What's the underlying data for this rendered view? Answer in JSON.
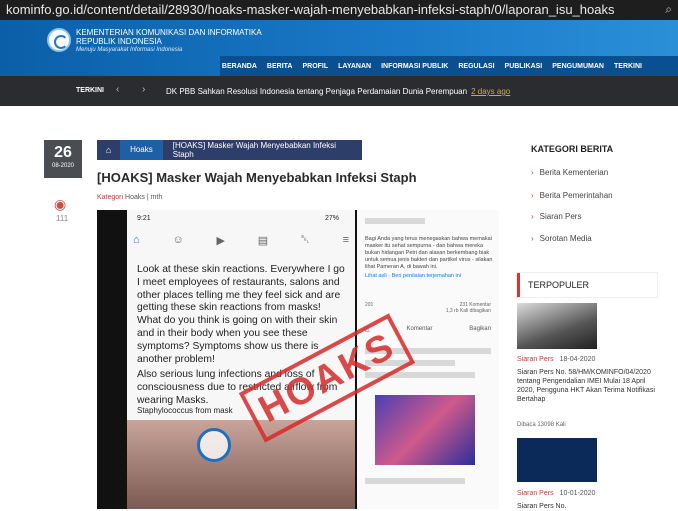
{
  "browser": {
    "url": "kominfo.go.id/content/detail/28930/hoaks-masker-wajah-menyebabkan-infeksi-staph/0/laporan_isu_hoaks"
  },
  "header": {
    "ministry_line1": "KEMENTERIAN KOMUNIKASI DAN INFORMATIKA",
    "ministry_line2": "REPUBLIK INDONESIA",
    "tagline": "Menuju Masyarakat Informasi Indonesia",
    "nav": [
      "BERANDA",
      "BERITA",
      "PROFIL",
      "LAYANAN",
      "INFORMASI PUBLIK",
      "REGULASI",
      "PUBLIKASI",
      "PENGUMUMAN",
      "TERKINI"
    ]
  },
  "ticker": {
    "label": "TERKINI",
    "headline": "DK PBB Sahkan Resolusi Indonesia tentang Penjaga Perdamaian Dunia Perempuan",
    "ago": "2 days ago"
  },
  "article": {
    "day": "26",
    "month_year": "08-2020",
    "views": "111",
    "breadcrumb_cat": "Hoaks",
    "breadcrumb_current": "[HOAKS] Masker Wajah Menyebabkan Infeksi Staph",
    "title": "[HOAKS] Masker Wajah Menyebabkan Infeksi Staph",
    "meta_label": "Kategori",
    "meta_cat": "Hoaks",
    "meta_author": "mth",
    "image": {
      "phone_time": "9:21",
      "phone_status": "27%",
      "post_text": "Look at these skin reactions. Everywhere I go I meet employees of restaurants, salons and other places telling me they feel sick and are getting these skin reactions from masks! What do you think is going on with their skin and in their body when you see these symptoms? Symptoms show us there is another problem!",
      "post_text2": "Also serious lung infections and loss of consciousness due to restricted airflow from wearing Masks.",
      "post_text3": "Staphylococcus from mask",
      "stamp": "HOAKS",
      "right_text": "Bagi Anda yang terus menegaskan bahwa memakai masker itu sehat sempurna - dan bahwa mereka bukan hidangan Petri dan alasan berkembang biak untuk semua jenis bakteri dan partikel virus - silakan lihat Pameran A, di bawah ini.",
      "right_link": "Lihat asli",
      "right_rate": "Beri penilaian terjemahan ini",
      "reactions": "201",
      "comments": "231 Komentar",
      "shares": "1,3 rb Kali dibagikan",
      "action_comment": "Komentar",
      "action_share": "Bagikan"
    }
  },
  "sidebar": {
    "kategori_title": "KATEGORI BERITA",
    "kategori": [
      "Berita Kementerian",
      "Berita Pemerintahan",
      "Siaran Pers",
      "Sorotan Media"
    ],
    "popular_title": "TERPOPULER",
    "popular": [
      {
        "category": "Siaran Pers",
        "date": "18-04-2020",
        "title": "Siaran Pers No. 58/HM/KOMINFO/04/2020 tentang Pengendalian IMEI Mulai 18 April 2020, Pengguna HKT Akan Terima Notifikasi Bertahap",
        "reads": "Dibaca 13098 Kali"
      },
      {
        "category": "Siaran Pers",
        "date": "10-01-2020",
        "title": "Siaran Pers No."
      }
    ]
  }
}
